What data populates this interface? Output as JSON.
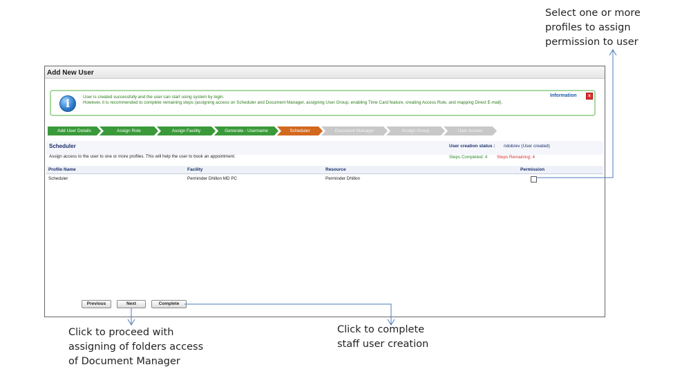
{
  "callouts": {
    "permission": "Select one or more\nprofiles to assign\npermission to user",
    "next": "Click to proceed with\nassigning of folders access\nof Document Manager",
    "complete": "Click to complete\nstaff user creation"
  },
  "window": {
    "title": "Add New User"
  },
  "info": {
    "message_line1": "User is created successfully and the user can start using system by login.",
    "message_line2": "However, it is recommended to complete remaining steps (assigning access on Scheduler and Document Manager, assigning User Group, enabling Time Card feature, creating Access Rule, and mapping Direct E-mail).",
    "label": "Information",
    "close": "x"
  },
  "steps": [
    {
      "label": "Add User Details",
      "state": "done"
    },
    {
      "label": "Assign Role",
      "state": "done"
    },
    {
      "label": "Assign Facility",
      "state": "done"
    },
    {
      "label": "Generate - Username",
      "state": "done"
    },
    {
      "label": "Scheduler",
      "state": "active"
    },
    {
      "label": "Document Manager",
      "state": "todo"
    },
    {
      "label": "Assign Group",
      "state": "todo"
    },
    {
      "label": "User Access",
      "state": "todo"
    }
  ],
  "section": {
    "title": "Scheduler",
    "description": "Assign access to the user to one or more profiles. This will help the user to book an appointment.",
    "status_label": "User creation status :",
    "status_value": "ndobrev (User created)",
    "steps_completed": "Steps Completed: 4",
    "steps_remaining": "Steps Remaining: 4"
  },
  "table": {
    "columns": [
      "Profile Name",
      "Facility",
      "Resource",
      "Permission"
    ],
    "rows": [
      {
        "profile": "Scheduler",
        "facility": "Perminder Dhillon MD PC",
        "resource": "Perminder Dhillon",
        "permission": false
      }
    ]
  },
  "buttons": {
    "previous": "Previous",
    "next": "Next",
    "complete": "Complete"
  },
  "colors": {
    "step_done": "#3a9a3a",
    "step_active": "#d2691e",
    "step_todo": "#c8c8c8",
    "callout_line": "#4a7ab8"
  }
}
